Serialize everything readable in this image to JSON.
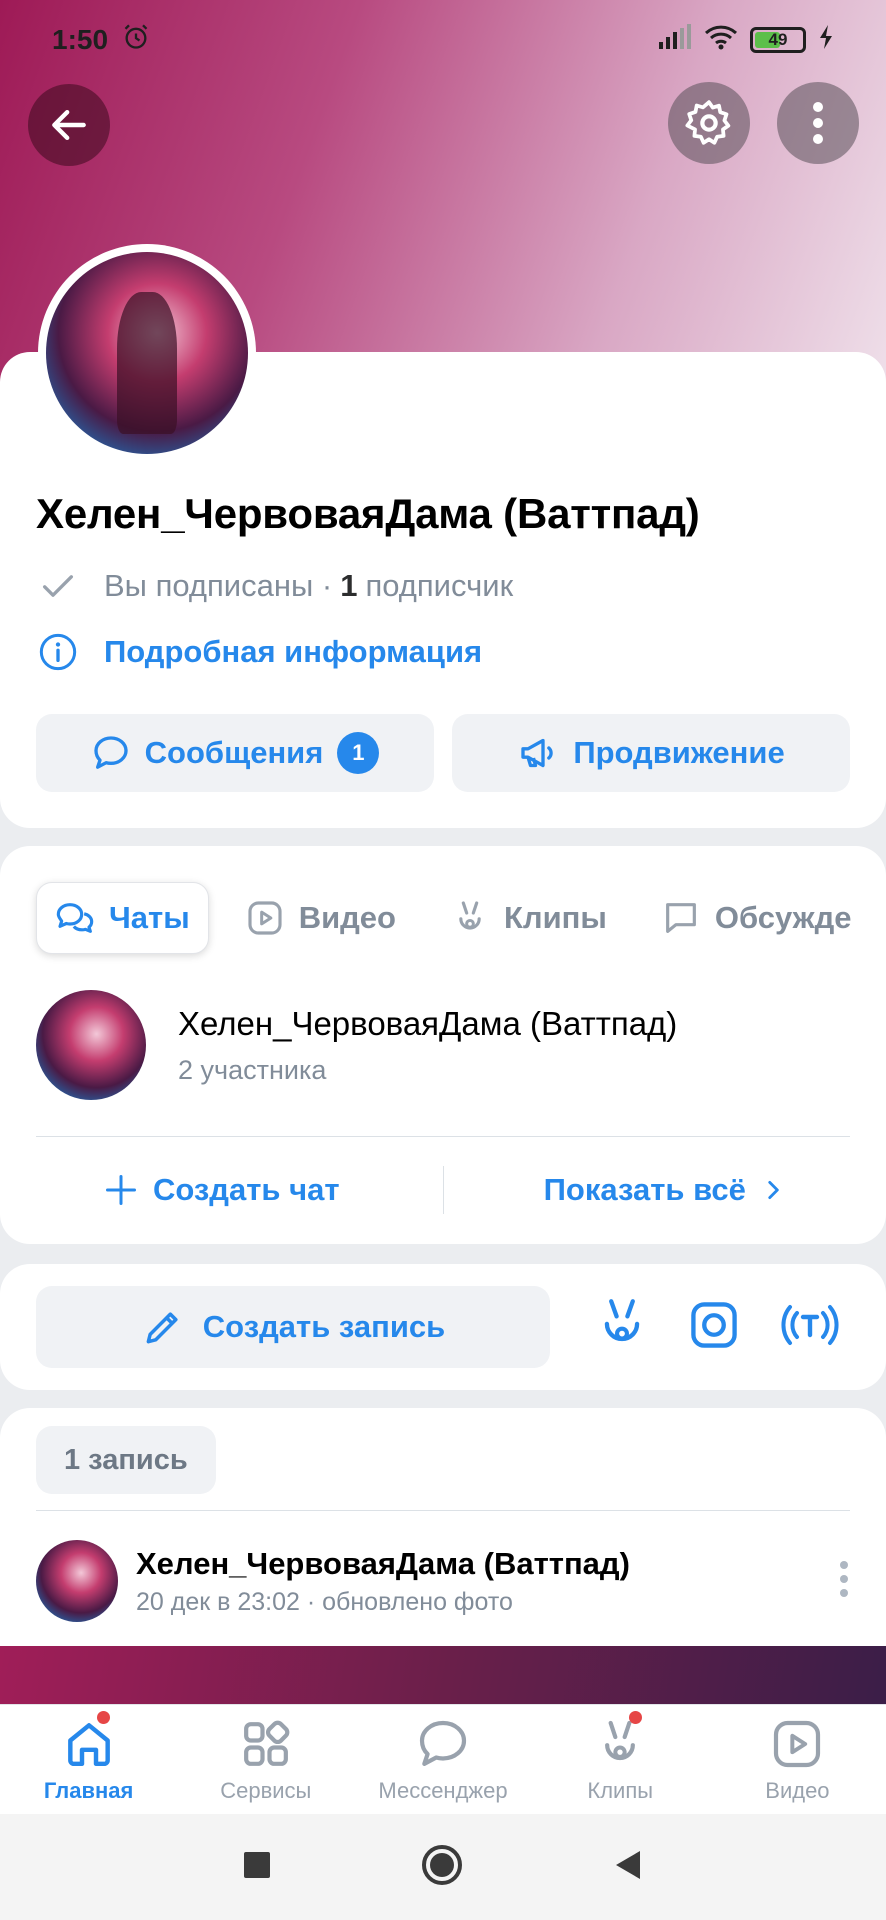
{
  "status_bar": {
    "time": "1:50",
    "battery": "49"
  },
  "header": {},
  "profile": {
    "name": "Хелен_ЧервоваяДама (Ваттпад)",
    "subscribed_text": "Вы подписаны ·",
    "subscriber_count": "1",
    "subscriber_word": "подписчик",
    "info_link": "Подробная информация",
    "messages_label": "Сообщения",
    "messages_badge": "1",
    "promotion_label": "Продвижение"
  },
  "tabs": [
    {
      "label": "Чаты",
      "icon": "chat-icon",
      "active": true
    },
    {
      "label": "Видео",
      "icon": "video-icon"
    },
    {
      "label": "Клипы",
      "icon": "clips-icon"
    },
    {
      "label": "Обсужде",
      "icon": "discussion-icon"
    }
  ],
  "chats": {
    "items": [
      {
        "title": "Хелен_ЧервоваяДама (Ваттпад)",
        "members": "2 участника"
      }
    ],
    "create_label": "Создать чат",
    "show_all_label": "Показать всё"
  },
  "composer": {
    "create_post_label": "Создать запись"
  },
  "feed": {
    "records_count": "1 запись",
    "post": {
      "author": "Хелен_ЧервоваяДама (Ваттпад)",
      "meta": "20 дек в 23:02 · обновлено фото"
    }
  },
  "bottom_nav": [
    {
      "label": "Главная",
      "icon": "home-icon",
      "active": true,
      "dot": true
    },
    {
      "label": "Сервисы",
      "icon": "services-icon"
    },
    {
      "label": "Мессенджер",
      "icon": "messenger-icon"
    },
    {
      "label": "Клипы",
      "icon": "clips-icon",
      "dot": true
    },
    {
      "label": "Видео",
      "icon": "video-icon"
    }
  ],
  "colors": {
    "accent": "#2688eb",
    "muted": "#818c99",
    "badge_red": "#e64646"
  }
}
